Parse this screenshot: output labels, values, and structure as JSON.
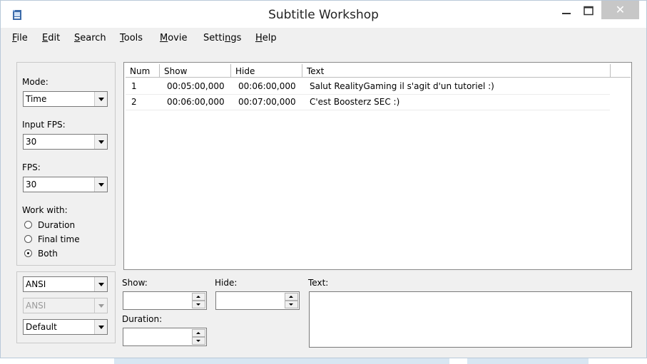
{
  "window": {
    "title": "Subtitle Workshop",
    "close_glyph": "✕",
    "icons": [
      "app-icon",
      "minimize-icon",
      "maximize-icon",
      "close-icon"
    ]
  },
  "menu": {
    "items": [
      {
        "key": "F",
        "rest": "ile"
      },
      {
        "key": "E",
        "rest": "dit"
      },
      {
        "key": "S",
        "rest": "earch"
      },
      {
        "key": "T",
        "rest": "ools"
      },
      {
        "key": "M",
        "rest": "ovie"
      },
      {
        "pre": "Setti",
        "key": "n",
        "rest": "gs"
      },
      {
        "key": "H",
        "rest": "elp"
      }
    ]
  },
  "left_panel": {
    "mode_label": "Mode:",
    "mode_value": "Time",
    "input_fps_label": "Input FPS:",
    "input_fps_value": "30",
    "fps_label": "FPS:",
    "fps_value": "30",
    "work_with_label": "Work with:",
    "work_with_options": [
      {
        "label": "Duration",
        "selected": false
      },
      {
        "label": "Final time",
        "selected": false
      },
      {
        "label": "Both",
        "selected": true
      }
    ],
    "charset1": "ANSI",
    "charset2": "ANSI",
    "format": "Default"
  },
  "list": {
    "columns": [
      "Num",
      "Show",
      "Hide",
      "Text"
    ],
    "rows": [
      {
        "num": "1",
        "show": "00:05:00,000",
        "hide": "00:06:00,000",
        "text": "Salut RealityGaming il s'agit d'un tutoriel :)"
      },
      {
        "num": "2",
        "show": "00:06:00,000",
        "hide": "00:07:00,000",
        "text": "C'est Boosterz SEC :)"
      }
    ]
  },
  "editor": {
    "show_label": "Show:",
    "hide_label": "Hide:",
    "duration_label": "Duration:",
    "text_label": "Text:",
    "show_value": "",
    "hide_value": "",
    "duration_value": "",
    "text_value": ""
  }
}
